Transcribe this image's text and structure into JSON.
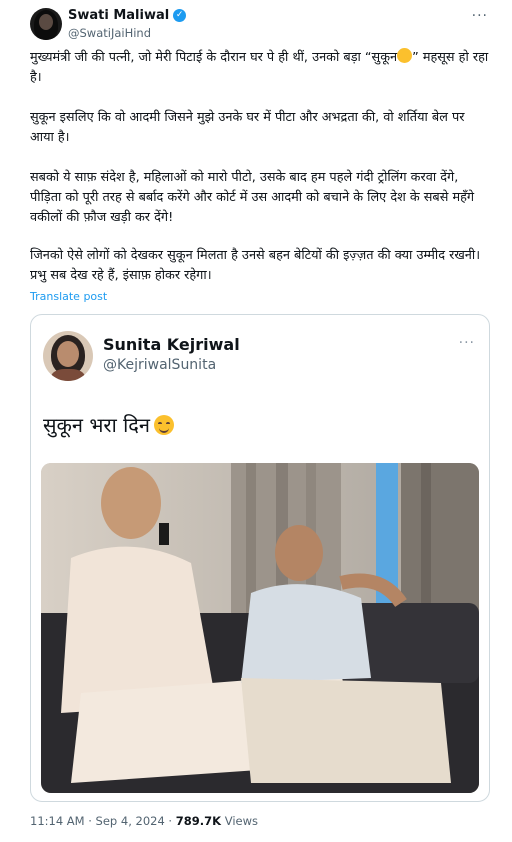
{
  "post": {
    "author_name": "Swati Maliwal",
    "author_handle": "@SwatiJaiHind",
    "more": "···",
    "paragraphs": [
      "मुख्यमंत्री जी की पत्नी, जो मेरी पिटाई के दौरान घर पे ही थीं, उनको बड़ा “सुकून",
      "” महसूस हो रहा है।",
      "सुकून इसलिए कि वो आदमी जिसने मुझे उनके घर में पीटा और अभद्रता की, वो शर्तिया बेल पर आया है।",
      "सबको ये साफ़ संदेश है, महिलाओं को मारो पीटो, उसके बाद हम पहले गंदी ट्रोलिंग करवा देंगे, पीड़िता को पूरी तरह से बर्बाद करेंगे और कोर्ट में उस आदमी को बचाने के लिए देश के सबसे महँगे वकीलों की फ़ौज खड़ी कर देंगे!",
      "जिनको ऐसे लोगों को देखकर सुकून मिलता है उनसे बहन बेटियों की इज़्ज़त की क्या उम्मीद रखनी। प्रभु सब देख रहे हैं, इंसाफ़ होकर रहेगा।"
    ],
    "translate": "Translate post",
    "timestamp": "11:14 AM · Sep 4, 2024 · ",
    "views_count": "789.7K",
    "views_label": " Views"
  },
  "quoted": {
    "author_name": "Sunita Kejriwal",
    "author_handle": "@KejriwalSunita",
    "more": "···",
    "text": "सुकून भरा दिन"
  },
  "icons": {
    "verified": "verified-badge-icon",
    "emoji": "smiling-face-with-hands-emoji"
  },
  "colors": {
    "link": "#1d9bf0",
    "muted": "#536471",
    "border": "#cfd9de"
  }
}
